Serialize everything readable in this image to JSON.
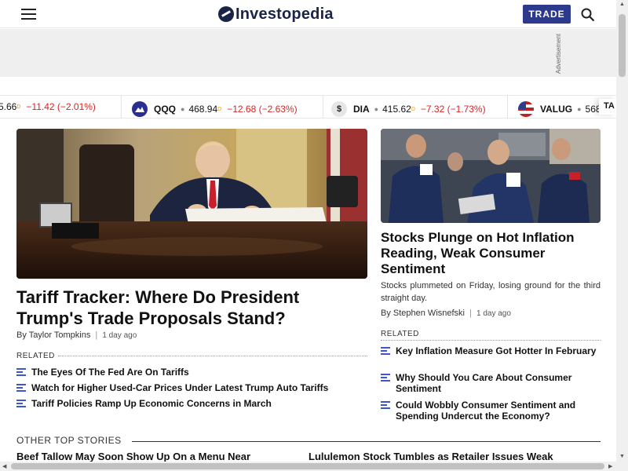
{
  "header": {
    "logo_text": "Investopedia",
    "trade_label": "TRADE"
  },
  "ad": {
    "label": "Advertisement"
  },
  "ticker": [
    {
      "symbol": "",
      "price": "5.66",
      "change": "−11.42 (−2.01%)"
    },
    {
      "symbol": "QQQ",
      "price": "468.94",
      "change": "−12.68 (−2.63%)",
      "icon": "qqq-icon"
    },
    {
      "symbol": "DIA",
      "price": "415.62",
      "change": "−7.32 (−1.73%)",
      "icon": "dollar-icon"
    },
    {
      "symbol": "VALUG",
      "price": "568.",
      "change": "",
      "icon": "us-flag-icon"
    }
  ],
  "ticker_trailing": "TA",
  "main_story": {
    "title": "Tariff Tracker: Where Do President Trump's Trade Proposals Stand?",
    "author": "By Taylor Tompkins",
    "date": "1 day ago",
    "related_label": "RELATED",
    "related": [
      "The Eyes Of The Fed Are On Tariffs",
      "Watch for Higher Used-Car Prices Under Latest Trump Auto Tariffs",
      "Tariff Policies Ramp Up Economic Concerns in March"
    ]
  },
  "side_story": {
    "title": "Stocks Plunge on Hot Inflation Reading, Weak Consumer Sentiment",
    "dek": "Stocks plummeted on Friday, losing ground for the third straight day.",
    "author": "By Stephen Wisnefski",
    "date": "1 day ago",
    "related_label": "RELATED",
    "related": [
      "Key Inflation Measure Got Hotter In February",
      "Why Should You Care About Consumer Sentiment",
      "Could Wobbly Consumer Sentiment and Spending Undercut the Economy?"
    ]
  },
  "other": {
    "heading": "OTHER TOP STORIES",
    "items": [
      "Beef Tallow May Soon Show Up On a Menu Near",
      "Lululemon Stock Tumbles as Retailer Issues Weak"
    ]
  },
  "colors": {
    "brand": "#1a2447",
    "trade": "#2d3a8c",
    "down": "#d72323",
    "related_icon": "#3d57c9"
  }
}
